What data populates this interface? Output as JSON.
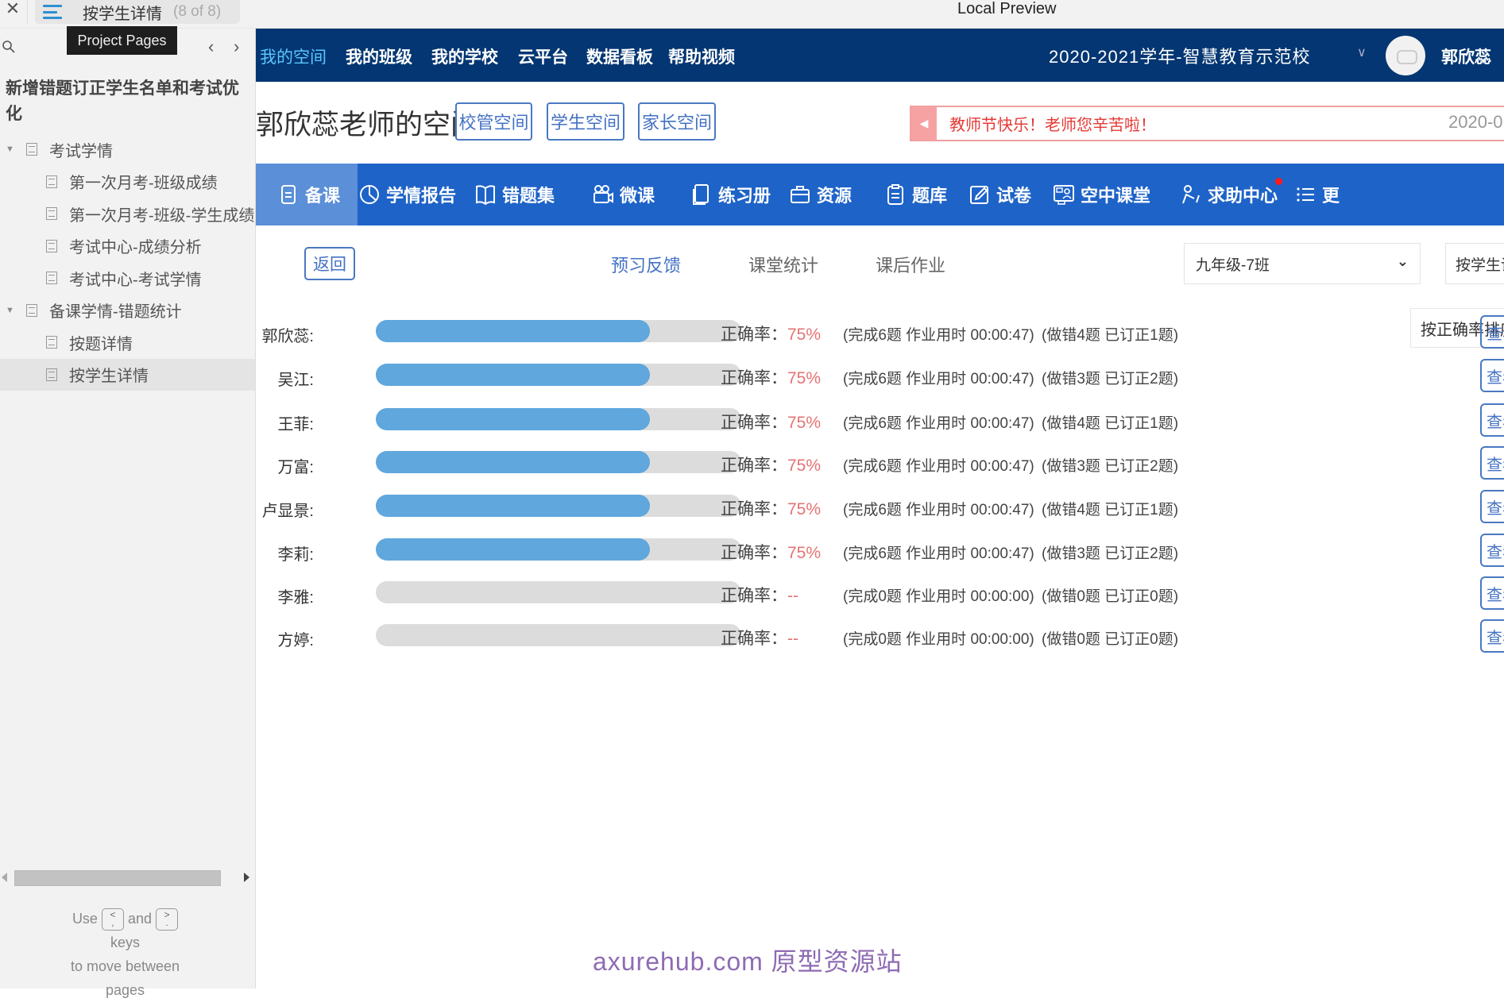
{
  "viewer": {
    "close_icon": "close-icon",
    "menu_icon": "hamburger-icon",
    "current_page": "按学生详情",
    "page_count": "(8 of 8)",
    "title": "Local Preview",
    "tooltip": "Project Pages",
    "project_title": "新增错题订正学生名单和考试优化",
    "tree": [
      {
        "label": "考试学情",
        "level": 1,
        "expanded": true
      },
      {
        "label": "第一次月考-班级成绩",
        "level": 2
      },
      {
        "label": "第一次月考-班级-学生成绩",
        "level": 2
      },
      {
        "label": "考试中心-成绩分析",
        "level": 2
      },
      {
        "label": "考试中心-考试学情",
        "level": 2
      },
      {
        "label": "备课学情-错题统计",
        "level": 1,
        "expanded": true
      },
      {
        "label": "按题详情",
        "level": 2
      },
      {
        "label": "按学生详情",
        "level": 2,
        "selected": true
      }
    ],
    "hint": {
      "use": "Use",
      "key_prev": "<",
      "key_prev_sub": ",",
      "and": "and",
      "key_next": ">",
      "key_next_sub": ".",
      "keys": "keys",
      "line2": "to move between",
      "line3": "pages"
    }
  },
  "topnav": {
    "items": [
      "我的空间",
      "我的班级",
      "我的学校",
      "云平台",
      "数据看板",
      "帮助视频"
    ],
    "active_index": 0,
    "school": "2020-2021学年-智慧教育示范校",
    "user": "郭欣蕊"
  },
  "space": {
    "title": "郭欣蕊老师的空间",
    "buttons": [
      "校管空间",
      "学生空间",
      "家长空间"
    ],
    "notice": "教师节快乐！老师您辛苦啦！",
    "notice_date": "2020-0"
  },
  "modules": {
    "items": [
      {
        "label": "备课",
        "icon": "document-icon"
      },
      {
        "label": "学情报告",
        "icon": "pie-chart-icon"
      },
      {
        "label": "错题集",
        "icon": "book-icon"
      },
      {
        "label": "微课",
        "icon": "video-camera-icon"
      },
      {
        "label": "练习册",
        "icon": "notebook-icon"
      },
      {
        "label": "资源",
        "icon": "briefcase-icon"
      },
      {
        "label": "题库",
        "icon": "clipboard-icon"
      },
      {
        "label": "试卷",
        "icon": "edit-icon"
      },
      {
        "label": "空中课堂",
        "icon": "live-class-icon"
      },
      {
        "label": "求助中心",
        "icon": "help-person-icon",
        "badge": true
      },
      {
        "label": "更",
        "icon": "list-icon"
      }
    ],
    "active_index": 0
  },
  "content": {
    "back": "返回",
    "tabs": [
      "预习反馈",
      "课堂统计",
      "课后作业"
    ],
    "active_tab": 0,
    "class_select": "九年级-7班",
    "mode_select": "按学生详情",
    "sort_button": "按正确率排序",
    "rate_label": "正确率：",
    "view_label": "查看",
    "students": [
      {
        "name": "郭欣蕊:",
        "progress": 0.75,
        "rate": "75%",
        "done": "(完成6题 作业用时 00:00:47)",
        "wrong": "(做错4题 已订正1题)"
      },
      {
        "name": "吴江:",
        "progress": 0.75,
        "rate": "75%",
        "done": "(完成6题 作业用时 00:00:47)",
        "wrong": "(做错3题 已订正2题)"
      },
      {
        "name": "王菲:",
        "progress": 0.75,
        "rate": "75%",
        "done": "(完成6题 作业用时 00:00:47)",
        "wrong": "(做错4题 已订正1题)"
      },
      {
        "name": "万富:",
        "progress": 0.75,
        "rate": "75%",
        "done": "(完成6题 作业用时 00:00:47)",
        "wrong": "(做错3题 已订正2题)"
      },
      {
        "name": "卢显景:",
        "progress": 0.75,
        "rate": "75%",
        "done": "(完成6题 作业用时 00:00:47)",
        "wrong": "(做错4题 已订正1题)"
      },
      {
        "name": "李莉:",
        "progress": 0.75,
        "rate": "75%",
        "done": "(完成6题 作业用时 00:00:47)",
        "wrong": "(做错3题 已订正2题)"
      },
      {
        "name": "李雅:",
        "progress": 0,
        "rate": "--",
        "done": "(完成0题 作业用时 00:00:00)",
        "wrong": "(做错0题 已订正0题)"
      },
      {
        "name": "方婷:",
        "progress": 0,
        "rate": "--",
        "done": "(完成0题 作业用时 00:00:00)",
        "wrong": "(做错0题 已订正0题)"
      }
    ]
  },
  "watermark": "axurehub.com 原型资源站",
  "colors": {
    "nav_dark": "#033672",
    "nav_blue": "#1e63c8",
    "bar_fill": "#5fa7dd",
    "rate_red": "#e57373",
    "accent": "#4472c4"
  }
}
